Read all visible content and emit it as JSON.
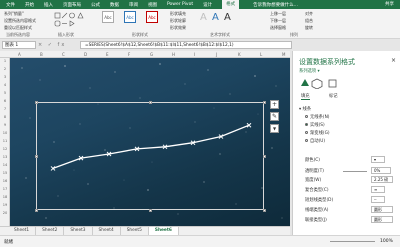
{
  "menu": {
    "tabs": [
      "文件",
      "开始",
      "插入",
      "页面布局",
      "公式",
      "数据",
      "审阅",
      "视图",
      "Power Pivot",
      "设计",
      "格式"
    ],
    "active_tab": "格式",
    "tell_me": "告诉我你想要做什么...",
    "share": "共享"
  },
  "ribbon": {
    "current_selection": "系列\"销量\"",
    "format_selection": "设置所选内容格式",
    "reset_style": "重设以匹配样式",
    "current_selection_group": "当前所选内容",
    "insert_shape_group": "插入形状",
    "style_sample": "Abc",
    "fill": "形状填充",
    "outline": "形状轮廓",
    "effect": "形状效果",
    "shape_styles_group": "形状样式",
    "art_styles_group": "艺术字样式",
    "up": "上移一层",
    "down": "下移一层",
    "pane": "选择窗格",
    "align": "对齐",
    "group": "组合",
    "rotate": "旋转",
    "arrange_group": "排列"
  },
  "formula_bar": {
    "name_box": "图表 1",
    "formula": "=SERIES(Sheet6!$A$12,Sheet6!$B$11:$I$11,Sheet6!$B$12:$I$12,1)"
  },
  "columns": [
    "A",
    "B",
    "C",
    "D",
    "E",
    "F",
    "G",
    "H",
    "I",
    "J",
    "K",
    "L",
    "M"
  ],
  "rows": [
    "1",
    "2",
    "3",
    "4",
    "5",
    "6",
    "7",
    "8",
    "9",
    "10",
    "11",
    "12",
    "13",
    "14",
    "15",
    "16",
    "17",
    "18",
    "19",
    "20"
  ],
  "sheet_tabs": [
    "Sheet1",
    "Sheet2",
    "Sheet3",
    "Sheet4",
    "Sheet5",
    "Sheet6"
  ],
  "active_sheet": "Sheet6",
  "status": {
    "ready": "就绪",
    "zoom": "100%"
  },
  "chart_buttons": {
    "add": "+",
    "style": "✎",
    "filter": "▼"
  },
  "chart_data": {
    "type": "line",
    "x": [
      1,
      2,
      3,
      4,
      5,
      6,
      7,
      8
    ],
    "values": [
      2.0,
      3.0,
      3.4,
      3.9,
      4.1,
      4.5,
      5.1,
      6.2
    ],
    "color": "#ffffff",
    "marker": "x",
    "background": "starry-night-image"
  },
  "panel": {
    "title": "设置数据系列格式",
    "subtitle": "系列选项 ▾",
    "tab_fill": "填充",
    "tab_marker": "标记",
    "section_line": "▾ 线条",
    "no_line": "无线条(N)",
    "solid_line": "实线(S)",
    "gradient_line": "渐变线(G)",
    "auto": "自动(U)",
    "color_label": "颜色(C)",
    "transparency_label": "透明度(T)",
    "transparency_value": "0%",
    "width_label": "宽度(W)",
    "width_value": "2.25 磅",
    "compound_label": "复合类型(C)",
    "dash_label": "短划线类型(D)",
    "cap_label": "线端类型(A)",
    "cap_value": "圆形",
    "join_label": "联接类型(J)",
    "join_value": "圆形"
  },
  "colors": {
    "accent": "#217346",
    "line": "#ffffff"
  }
}
